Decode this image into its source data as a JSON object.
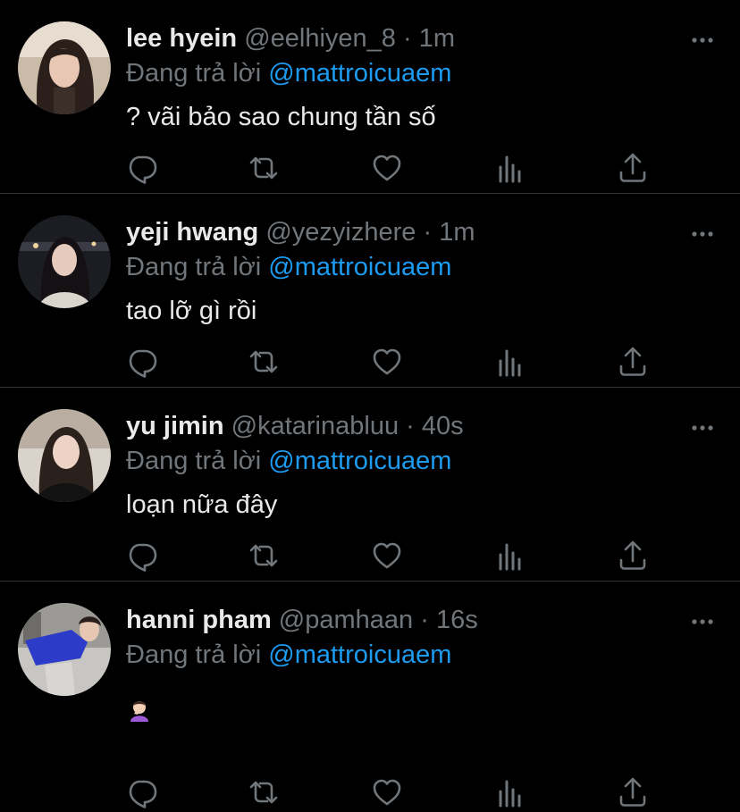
{
  "colors": {
    "background": "#000000",
    "text": "#e7e9ea",
    "secondary": "#71767b",
    "accent": "#1d9bf0",
    "divider": "#2f3336"
  },
  "tweets": [
    {
      "name": "lee hyein",
      "handle": "@eelhiyen_8",
      "dot": "·",
      "time": "1m",
      "reply_prefix": "Đang trả lời",
      "reply_user": "@mattroicuaem",
      "text": "? vãi bảo sao chung tần số"
    },
    {
      "name": "yeji hwang",
      "handle": "@yezyizhere",
      "dot": "·",
      "time": "1m",
      "reply_prefix": "Đang trả lời",
      "reply_user": "@mattroicuaem",
      "text": "tao lỡ gì rồi"
    },
    {
      "name": "yu jimin",
      "handle": "@katarinabluu",
      "dot": "·",
      "time": "40s",
      "reply_prefix": "Đang trả lời",
      "reply_user": "@mattroicuaem",
      "text": "loạn nữa đây"
    },
    {
      "name": "hanni pham",
      "handle": "@pamhaan",
      "dot": "·",
      "time": "16s",
      "reply_prefix": "Đang trả lời",
      "reply_user": "@mattroicuaem",
      "text": ""
    }
  ],
  "icons": {
    "more": "more-horizontal-icon",
    "reply": "reply-bubble-icon",
    "retweet": "retweet-icon",
    "like": "heart-icon",
    "views": "views-bar-chart-icon",
    "share": "share-upload-icon",
    "emoji": "person-facepalming-emoji"
  }
}
